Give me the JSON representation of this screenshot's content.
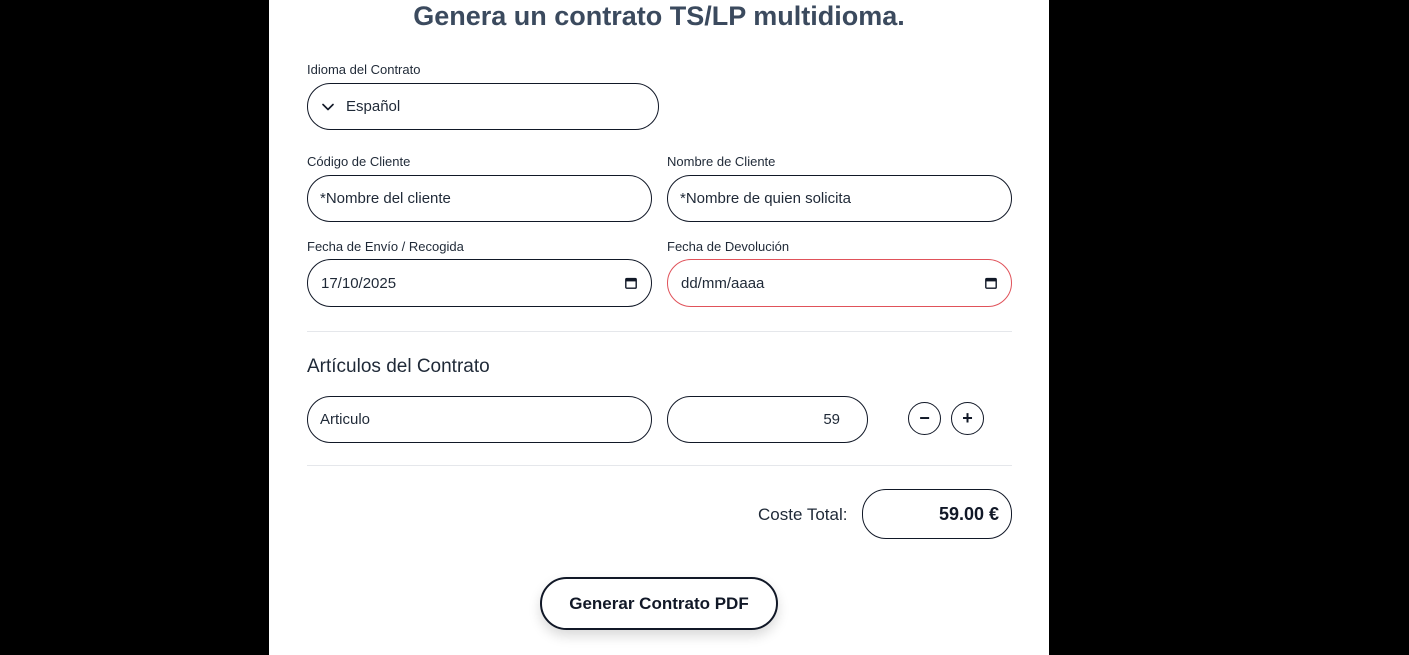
{
  "page": {
    "title": "Genera un contrato TS/LP multidioma."
  },
  "language": {
    "label": "Idioma del Contrato",
    "selected": "Español",
    "icon": "chevron-down-icon"
  },
  "client_code": {
    "label": "Código de Cliente",
    "placeholder": "*Nombre del cliente"
  },
  "client_name": {
    "label": "Nombre de Cliente",
    "placeholder": "*Nombre de quien solicita"
  },
  "ship_date": {
    "label": "Fecha de Envío / Recogida",
    "value": "17/10/2025",
    "icon": "calendar-icon"
  },
  "return_date": {
    "label": "Fecha de Devolución",
    "placeholder": "dd/mm/aaaa",
    "icon": "calendar-icon",
    "error_color": "#e0525a"
  },
  "articles": {
    "title": "Artículos del Contrato",
    "items": [
      {
        "name": "Articulo",
        "price": "59"
      }
    ],
    "remove_label": "−",
    "add_label": "+"
  },
  "total": {
    "label": "Coste Total:",
    "value": "59.00 €"
  },
  "generate_button": {
    "label": "Generar Contrato PDF"
  }
}
